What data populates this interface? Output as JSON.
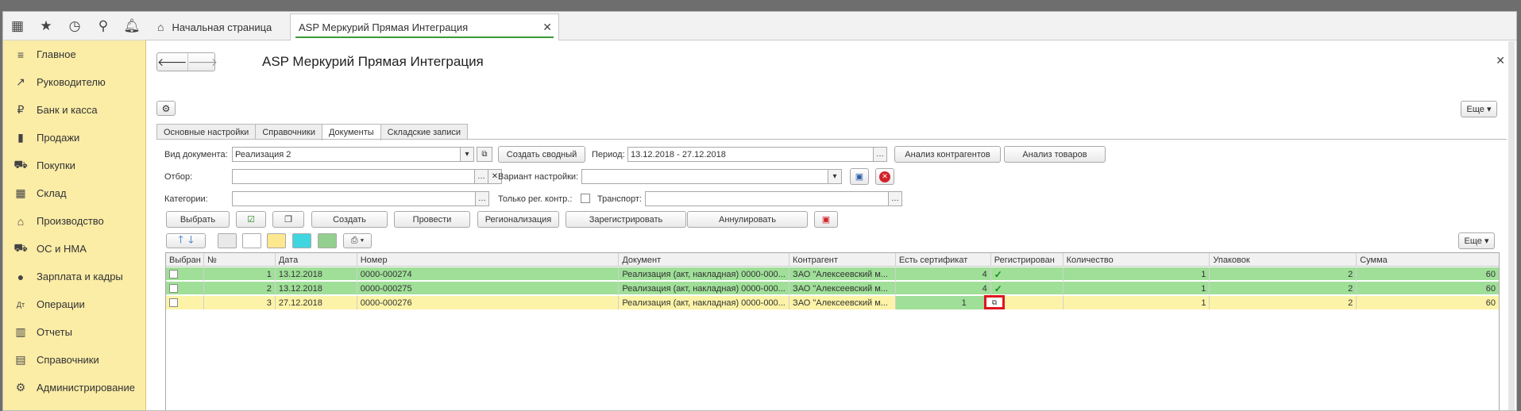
{
  "topbar": {
    "icons": [
      "apps-grid-icon",
      "star-icon",
      "history-icon",
      "search-icon",
      "bell-icon"
    ]
  },
  "sidebar": {
    "items": [
      {
        "label": "Главное",
        "icon": "≡"
      },
      {
        "label": "Руководителю",
        "icon": "↗"
      },
      {
        "label": "Банк и касса",
        "icon": "₽"
      },
      {
        "label": "Продажи",
        "icon": "▮"
      },
      {
        "label": "Покупки",
        "icon": "⛟"
      },
      {
        "label": "Склад",
        "icon": "▦"
      },
      {
        "label": "Производство",
        "icon": "⌂"
      },
      {
        "label": "ОС и НМА",
        "icon": "⛟"
      },
      {
        "label": "Зарплата и кадры",
        "icon": "●"
      },
      {
        "label": "Операции",
        "icon": "Дт"
      },
      {
        "label": "Отчеты",
        "icon": "▥"
      },
      {
        "label": "Справочники",
        "icon": "▤"
      },
      {
        "label": "Администрирование",
        "icon": "⚙"
      }
    ]
  },
  "tabs": {
    "home": "Начальная страница",
    "active": "ASP Меркурий Прямая Интеграция"
  },
  "page": {
    "title": "ASP Меркурий Прямая Интеграция",
    "more": "Еще ▾"
  },
  "formtabs": [
    "Основные настройки",
    "Справочники",
    "Документы",
    "Складские записи"
  ],
  "form": {
    "doc_type_label": "Вид документа:",
    "doc_type_value": "Реализация 2",
    "create_summary": "Создать сводный",
    "period_label": "Период:",
    "period_value": "13.12.2018 - 27.12.2018",
    "analysis_contractors": "Анализ контрагентов",
    "analysis_goods": "Анализ товаров",
    "filter_label": "Отбор:",
    "variant_label": "Вариант настройки:",
    "categories_label": "Категории:",
    "only_reg_label": "Только рег. контр.:",
    "transport_label": "Транспорт:"
  },
  "actions": {
    "select": "Выбрать",
    "create": "Создать",
    "post": "Провести",
    "regionalization": "Регионализация",
    "register": "Зарегистрировать",
    "cancel": "Аннулировать",
    "more": "Еще ▾"
  },
  "grid": {
    "columns": [
      "Выбран",
      "№",
      "Дата",
      "Номер",
      "Документ",
      "Контрагент",
      "Есть сертификат",
      "Регистрирован",
      "Количество",
      "Упаковок",
      "Сумма"
    ],
    "rows": [
      {
        "n": "1",
        "date": "13.12.2018",
        "number": "0000-000274",
        "doc": "Реализация (акт, накладная) 0000-000...",
        "contractor": "ЗАО \"Алексеевский м...",
        "cert": "4",
        "qty": "1",
        "pack": "2",
        "sum": "60"
      },
      {
        "n": "2",
        "date": "13.12.2018",
        "number": "0000-000275",
        "doc": "Реализация (акт, накладная) 0000-000...",
        "contractor": "ЗАО \"Алексеевский м...",
        "cert": "4",
        "qty": "1",
        "pack": "2",
        "sum": "60"
      },
      {
        "n": "3",
        "date": "27.12.2018",
        "number": "0000-000276",
        "doc": "Реализация (акт, накладная) 0000-000...",
        "contractor": "ЗАО \"Алексеевский м...",
        "cert": "1",
        "qty": "1",
        "pack": "2",
        "sum": "60"
      }
    ]
  },
  "colors": {
    "sidebar": "#fbeca6",
    "row_green": "#9fdf98",
    "row_yellow": "#fdf3a8",
    "highlight": "#e0141e"
  }
}
